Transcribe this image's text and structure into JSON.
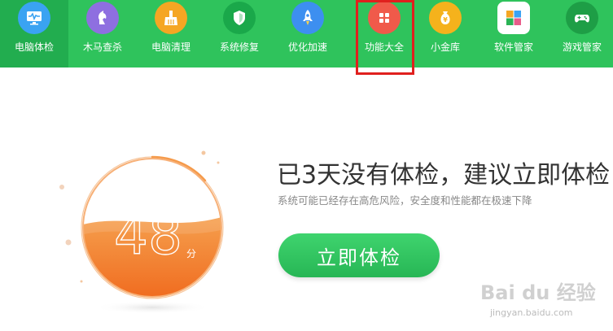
{
  "nav": {
    "items": [
      {
        "label": "电脑体检",
        "icon": "monitor-check-icon",
        "color": "#3aa3f2"
      },
      {
        "label": "木马查杀",
        "icon": "horse-icon",
        "color": "#8e6fe0"
      },
      {
        "label": "电脑清理",
        "icon": "broom-icon",
        "color": "#f5a623"
      },
      {
        "label": "系统修复",
        "icon": "shield-icon",
        "color": "#1aa84a"
      },
      {
        "label": "优化加速",
        "icon": "rocket-icon",
        "color": "#3d8ff0"
      },
      {
        "label": "功能大全",
        "icon": "grid-apps-icon",
        "color": "#f05a4a"
      },
      {
        "label": "小金库",
        "icon": "yen-bag-icon",
        "color": "#f5b21c"
      },
      {
        "label": "软件管家",
        "icon": "software-cube-icon",
        "color": "#e85c8a"
      },
      {
        "label": "游戏管家",
        "icon": "gamepad-icon",
        "color": "#2ab355"
      }
    ],
    "active_color": "#22ad4f",
    "bar_color": "#2fc35c"
  },
  "gauge": {
    "score": "48",
    "unit": "分",
    "fill_level": 0.55
  },
  "main": {
    "headline": "已3天没有体检，建议立即体检！",
    "subline": "系统可能已经存在高危风险，安全度和性能都在极速下降",
    "button_label": "立即体检"
  },
  "watermark": {
    "logo": "Bai du 经验",
    "url": "jingyan.baidu.com"
  }
}
